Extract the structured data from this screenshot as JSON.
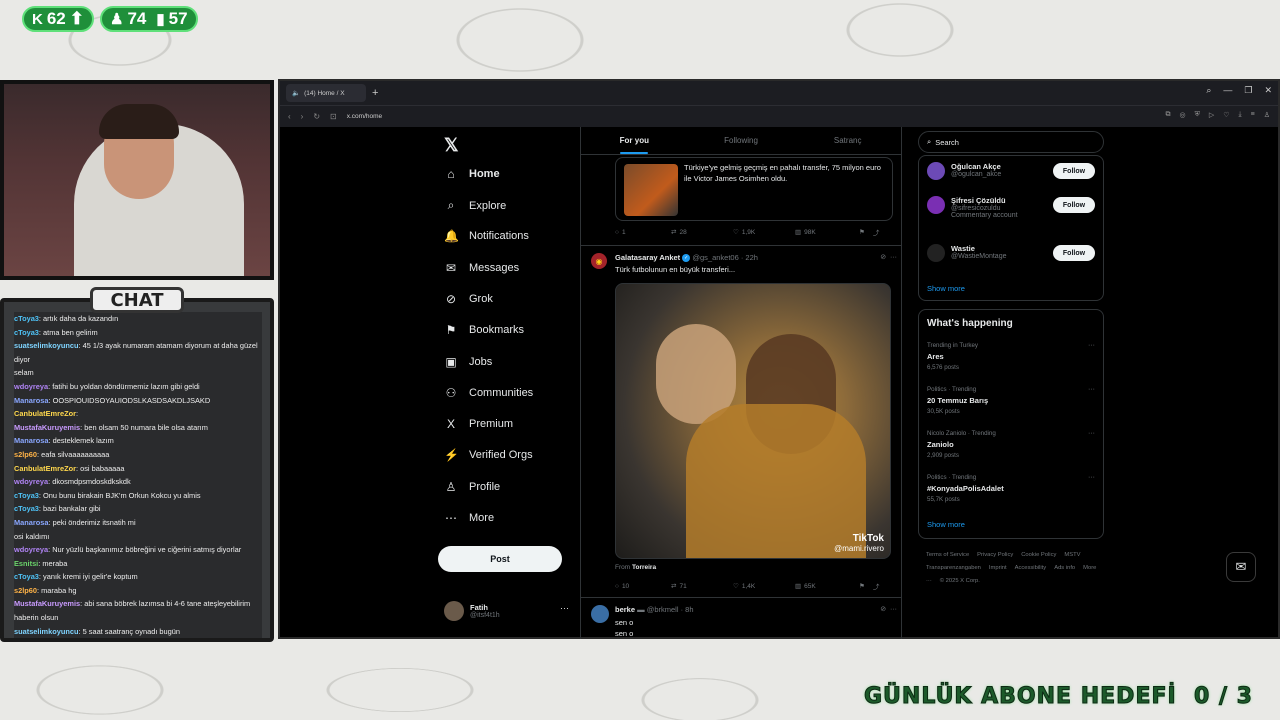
{
  "overlay": {
    "stats": [
      {
        "icon": "K",
        "value": "62",
        "trend": "⬆"
      },
      {
        "icon": "♟",
        "value": "74"
      },
      {
        "icon": "📶",
        "value": "57"
      }
    ],
    "chat_label": "CHAT",
    "goal_text": "GÜNLÜK ABONE HEDEFİ",
    "goal_progress": "0 / 3"
  },
  "chat": [
    {
      "user": "cToya3",
      "msg": "artık daha da kazandın",
      "color": "#4fc3f7"
    },
    {
      "user": "cToya3",
      "msg": "atma ben gelirim",
      "color": "#4fc3f7"
    },
    {
      "user": "suatselimkoyuncu",
      "msg": "45 1/3 ayak numaram atamam diyorum at daha güzel diyor",
      "color": "#7fd4ff"
    },
    {
      "user": "",
      "msg": "selam",
      "color": "#c04848"
    },
    {
      "user": "wdoyreya",
      "msg": "fatihi bu yoldan döndürmemiz lazım gibi geldi",
      "color": "#b084f5"
    },
    {
      "user": "Manarosa",
      "msg": "OOSPIOUIDSOYAUIODSLKASDSAKDLJSAKD",
      "color": "#8aa7ff"
    },
    {
      "user": "CanbulatEmreZor",
      "msg": "",
      "color": "#ffd84d"
    },
    {
      "user": "MustafaKuruyemis",
      "msg": "ben olsam 50 numara bile olsa atarım",
      "color": "#c99bff"
    },
    {
      "user": "Manarosa",
      "msg": "desteklemek lazım",
      "color": "#8aa7ff"
    },
    {
      "user": "s2lp60",
      "msg": "eafa silvaaaaaaaaaa",
      "color": "#ffb347"
    },
    {
      "user": "CanbulatEmreZor",
      "msg": "osi babaaaaa",
      "color": "#ffd84d"
    },
    {
      "user": "wdoyreya",
      "msg": "dkosmdpsmdoskdkskdk",
      "color": "#b084f5"
    },
    {
      "user": "cToya3",
      "msg": "Onu bunu birakain BJK'm Orkun Kokcu yu almis",
      "color": "#4fc3f7"
    },
    {
      "user": "cToya3",
      "msg": "bazi bankalar gibi",
      "color": "#4fc3f7"
    },
    {
      "user": "Manarosa",
      "msg": "peki önderimiz itsnatih mi",
      "color": "#8aa7ff"
    },
    {
      "user": "",
      "msg": "osi kaldımı",
      "color": "#c04848"
    },
    {
      "user": "wdoyreya",
      "msg": "Nur yüzlü başkanımız böbreğini ve ciğerini satmış diyorlar",
      "color": "#b084f5"
    },
    {
      "user": "Esnitsi",
      "msg": "meraba",
      "color": "#6bd46b"
    },
    {
      "user": "cToya3",
      "msg": "yanık kremi iyi gelir'e koptum",
      "color": "#4fc3f7"
    },
    {
      "user": "s2lp60",
      "msg": "maraba hg",
      "color": "#ffb347"
    },
    {
      "user": "MustafaKuruyemis",
      "msg": "abi sana böbrek lazımsa bi 4-6 tane ateşleyebilirim haberin olsun",
      "color": "#c99bff"
    },
    {
      "user": "suatselimkoyuncu",
      "msg": "5 saat saatranç oynadı bugün",
      "color": "#7fd4ff"
    }
  ],
  "browser": {
    "tab_title": "(14) Home / X",
    "url": "x.com/home"
  },
  "nav": {
    "items": [
      {
        "label": "Home",
        "icon": "⌂"
      },
      {
        "label": "Explore",
        "icon": "⌕"
      },
      {
        "label": "Notifications",
        "icon": "🔔",
        "badge": "14"
      },
      {
        "label": "Messages",
        "icon": "✉"
      },
      {
        "label": "Grok",
        "icon": "⊘"
      },
      {
        "label": "Bookmarks",
        "icon": "⚑"
      },
      {
        "label": "Jobs",
        "icon": "▣"
      },
      {
        "label": "Communities",
        "icon": "⚇"
      },
      {
        "label": "Premium",
        "icon": "X"
      },
      {
        "label": "Verified Orgs",
        "icon": "⚡"
      },
      {
        "label": "Profile",
        "icon": "♙"
      },
      {
        "label": "More",
        "icon": "⋯"
      }
    ],
    "post_label": "Post",
    "me_name": "Fatih",
    "me_handle": "@itsf4t1h"
  },
  "feed": {
    "tabs": [
      "For you",
      "Following",
      "Satranç"
    ],
    "quote_text": "Türkiye'ye gelmiş geçmiş en pahalı transfer, 75 milyon euro ile Victor James Osimhen oldu.",
    "actions1": {
      "reply": "1",
      "repost": "28",
      "like": "1,9K",
      "views": "98K"
    },
    "tweet": {
      "name": "Galatasaray Anket",
      "handle": "@gs_anket06 · 22h",
      "text": "Türk futbolunun en büyük transferi...",
      "tiktok": "TikTok",
      "tiktok_handle": "@mami.rivero",
      "from_label": "From",
      "from_user": "Torreira"
    },
    "actions2": {
      "reply": "10",
      "repost": "71",
      "like": "1,4K",
      "views": "65K"
    },
    "tweet2": {
      "name": "berke",
      "handle": "@brkmell · 8h",
      "line1": "sen o",
      "line2": "sen o"
    }
  },
  "sidebar": {
    "search_placeholder": "Search",
    "follow": [
      {
        "name": "Oğulcan Akçe",
        "handle": "@ogulcan_akce",
        "sub": "",
        "btn": "Follow"
      },
      {
        "name": "Şifresi Çözüldü",
        "handle": "@sifresicozuldu",
        "sub": "Commentary account",
        "btn": "Follow"
      },
      {
        "name": "Wastie",
        "handle": "@WastieMontage",
        "sub": "",
        "btn": "Follow"
      }
    ],
    "show_more": "Show more",
    "happening_title": "What's happening",
    "trends": [
      {
        "meta": "Trending in Turkey",
        "name": "Ares",
        "posts": "6,576 posts"
      },
      {
        "meta": "Politics · Trending",
        "name": "20 Temmuz Barış",
        "posts": "30,5K posts"
      },
      {
        "meta": "Nicolo Zaniolo · Trending",
        "name": "Zaniolo",
        "posts": "2,909 posts"
      },
      {
        "meta": "Politics · Trending",
        "name": "#KonyadaPolisAdalet",
        "posts": "55,7K posts"
      }
    ],
    "footer": [
      "Terms of Service",
      "Privacy Policy",
      "Cookie Policy",
      "MSTV Transparenzangaben",
      "Imprint",
      "Accessibility",
      "Ads info",
      "More ···",
      "© 2025 X Corp."
    ]
  }
}
